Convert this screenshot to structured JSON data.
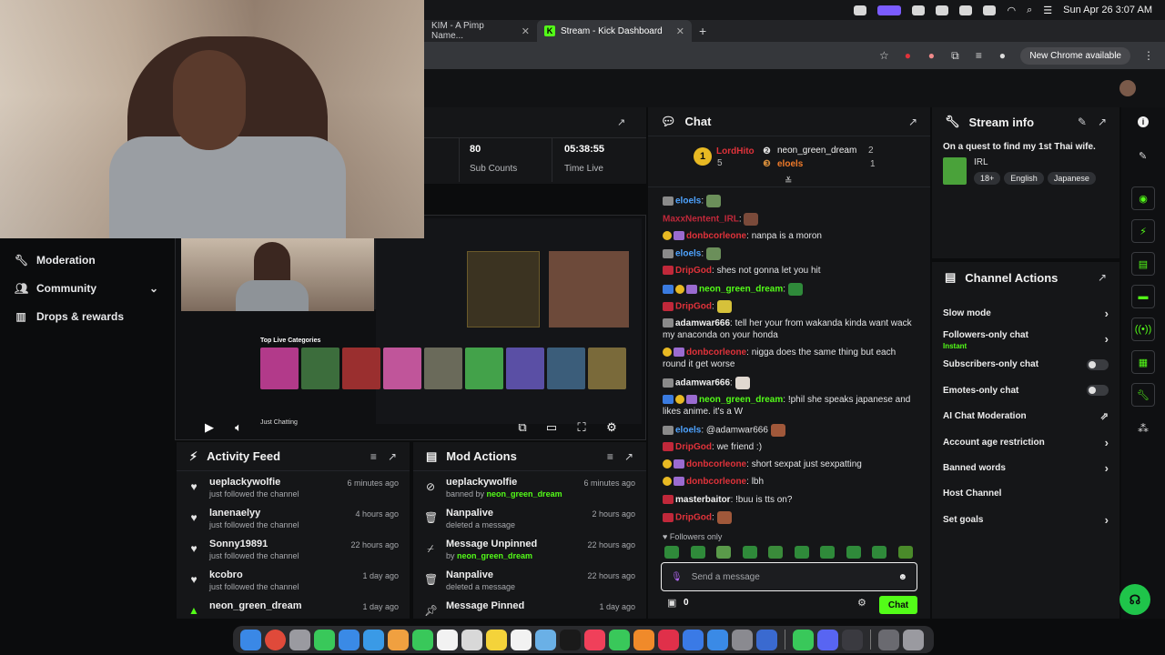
{
  "menubar": {
    "datetime": "Sun Apr 26  3:07 AM"
  },
  "browser": {
    "tabs": [
      {
        "label": "KIM - A Pimp Name...",
        "active": false
      },
      {
        "label": "Stream - Kick Dashboard",
        "active": true
      }
    ],
    "new_tab": "+",
    "update_notice": "New Chrome available"
  },
  "sidebar": {
    "items": [
      {
        "label": "Moderation",
        "icon": "wrench-icon"
      },
      {
        "label": "Community",
        "icon": "people-icon",
        "expandable": true
      },
      {
        "label": "Drops & rewards",
        "icon": "gift-icon"
      }
    ]
  },
  "stats": {
    "sub_counts_value": "80",
    "sub_counts_label": "Sub Counts",
    "time_live_value": "05:38:55",
    "time_live_label": "Time Live"
  },
  "preview": {
    "category_label": "Top Live Categories",
    "now_playing": "Just Chatting"
  },
  "activity_feed": {
    "title": "Activity Feed",
    "items": [
      {
        "name": "ueplackywolfie",
        "detail": "just followed the channel",
        "time": "6 minutes ago"
      },
      {
        "name": "lanenaelyy",
        "detail": "just followed the channel",
        "time": "4 hours ago"
      },
      {
        "name": "Sonny19891",
        "detail": "just followed the channel",
        "time": "22 hours ago"
      },
      {
        "name": "kcobro",
        "detail": "just followed the channel",
        "time": "1 day ago"
      },
      {
        "name": "neon_green_dream",
        "detail": "",
        "time": "1 day ago"
      }
    ]
  },
  "mod_actions": {
    "title": "Mod Actions",
    "items": [
      {
        "name": "ueplackywolfie",
        "detail_prefix": "banned by ",
        "detail_user": "neon_green_dream",
        "time": "6 minutes ago",
        "icon": "ban-icon"
      },
      {
        "name": "Nanpalive",
        "detail_prefix": "deleted a message",
        "detail_user": "",
        "time": "2 hours ago",
        "icon": "trash-icon"
      },
      {
        "name": "Message Unpinned",
        "detail_prefix": "by ",
        "detail_user": "neon_green_dream",
        "time": "22 hours ago",
        "icon": "unpin-icon"
      },
      {
        "name": "Nanpalive",
        "detail_prefix": "deleted a message",
        "detail_user": "",
        "time": "22 hours ago",
        "icon": "trash-icon"
      },
      {
        "name": "Message Pinned",
        "detail_prefix": "",
        "detail_user": "",
        "time": "1 day ago",
        "icon": "pin-icon"
      }
    ]
  },
  "chat": {
    "title": "Chat",
    "leaderboard": {
      "first": {
        "rank": "1",
        "name": "LordHito",
        "count": "5"
      },
      "second": {
        "name": "neon_green_dream",
        "count": "2"
      },
      "third": {
        "name": "eloels",
        "count": "1"
      }
    },
    "messages": [
      {
        "user": "eloels",
        "text": ""
      },
      {
        "user": "MaxxNentent_IRL",
        "text": ""
      },
      {
        "user": "eloels",
        "text": ""
      },
      {
        "user": "donbcorleone",
        "text": "nanpa is a moron"
      },
      {
        "user": "eloels",
        "text": ""
      },
      {
        "user": "DripGod",
        "text": "shes not gonna let you hit"
      },
      {
        "user": "neon_green_dream",
        "text": ""
      },
      {
        "user": "DripGod",
        "text": ""
      },
      {
        "user": "adamwar666",
        "text": "tell her your from wakanda kinda want wack my anaconda on your honda"
      },
      {
        "user": "donbcorleone",
        "text": "nigga does the same thing but each round it get worse"
      },
      {
        "user": "adamwar666",
        "text": ""
      },
      {
        "user": "neon_green_dream",
        "text": "!phil she speaks japanese and likes anime. it's a W"
      },
      {
        "user": "eloels",
        "text": "@adamwar666"
      },
      {
        "user": "DripGod",
        "text": "we friend :)"
      },
      {
        "user": "donbcorleone",
        "text": "short sexpat just sexpatting"
      },
      {
        "user": "donbcorleone",
        "text": "lbh"
      },
      {
        "user": "masterbaitor",
        "text": "!buu is tts on?"
      },
      {
        "user": "DripGod",
        "text": ""
      }
    ],
    "followers_only_label": "Followers only",
    "input_placeholder": "Send a message",
    "points": "0",
    "send_label": "Chat"
  },
  "stream_info": {
    "title": "Stream info",
    "stream_title": "On a quest to find my 1st Thai wife.",
    "category": "IRL",
    "tags": [
      "18+",
      "English",
      "Japanese"
    ]
  },
  "channel_actions": {
    "title": "Channel Actions",
    "items": [
      {
        "label": "Slow mode",
        "control": "chevron"
      },
      {
        "label": "Followers-only chat",
        "sub": "Instant",
        "control": "chevron"
      },
      {
        "label": "Subscribers-only chat",
        "control": "toggle"
      },
      {
        "label": "Emotes-only chat",
        "control": "toggle"
      },
      {
        "label": "AI Chat Moderation",
        "control": "external"
      },
      {
        "label": "Account age restriction",
        "control": "chevron"
      },
      {
        "label": "Banned words",
        "control": "chevron"
      },
      {
        "label": "Host Channel",
        "control": "none"
      },
      {
        "label": "Set goals",
        "control": "chevron"
      }
    ]
  },
  "colors": {
    "accent": "#53fc18",
    "bg": "#0b0c0d",
    "panel": "#151618",
    "username_red": "#e0323a"
  }
}
